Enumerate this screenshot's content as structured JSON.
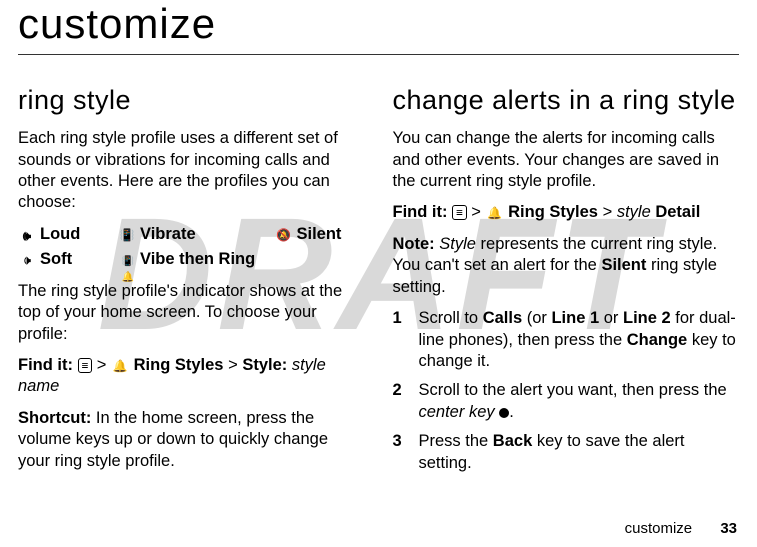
{
  "watermark": "DRAFT",
  "title": "customize",
  "left": {
    "heading": "ring style",
    "p1": "Each ring style profile uses a different set of sounds or vibrations for incoming calls and other events. Here are the profiles you can choose:",
    "profiles": {
      "loud": "Loud",
      "vibrate": "Vibrate",
      "silent": "Silent",
      "soft": "Soft",
      "vtr": "Vibe then Ring"
    },
    "p2": "The ring style profile's indicator shows at the top of your home screen. To choose your profile:",
    "findit_label": "Find it:",
    "findit_gt1": ">",
    "findit_ringstyles": "Ring Styles",
    "findit_gt2": ">",
    "findit_style": "Style:",
    "findit_stylename": "style name",
    "shortcut_label": "Shortcut:",
    "shortcut_text": " In the home screen, press the volume keys up or down to quickly change your ring style profile."
  },
  "right": {
    "heading": "change alerts in a ring style",
    "p1": "You can change the alerts for incoming calls and other events. Your changes are saved in the current ring style profile.",
    "findit_label": "Find it:",
    "findit_gt1": ">",
    "findit_ringstyles": "Ring Styles",
    "findit_gt2": ">",
    "findit_style_italic": "style",
    "findit_detail": "Detail",
    "note_label": "Note:",
    "note_text1": " Style",
    "note_text2": " represents the current ring style. You can't set an alert for the ",
    "note_silent": "Silent",
    "note_text3": " ring style setting.",
    "steps": [
      {
        "num": "1",
        "t1": "Scroll to ",
        "t_calls": "Calls",
        "t2": " (or ",
        "t_line1": "Line 1",
        "t3": " or ",
        "t_line2": "Line 2",
        "t4": " for dual-line phones), then press the ",
        "t_change": "Change",
        "t5": " key to change it."
      },
      {
        "num": "2",
        "t1": "Scroll to the alert you want, then press the ",
        "t_center": "center key",
        "t2": "."
      },
      {
        "num": "3",
        "t1": "Press the ",
        "t_back": "Back",
        "t2": " key to save the alert setting."
      }
    ]
  },
  "footer": {
    "text": "customize",
    "page": "33"
  },
  "menu_glyph": "≡"
}
